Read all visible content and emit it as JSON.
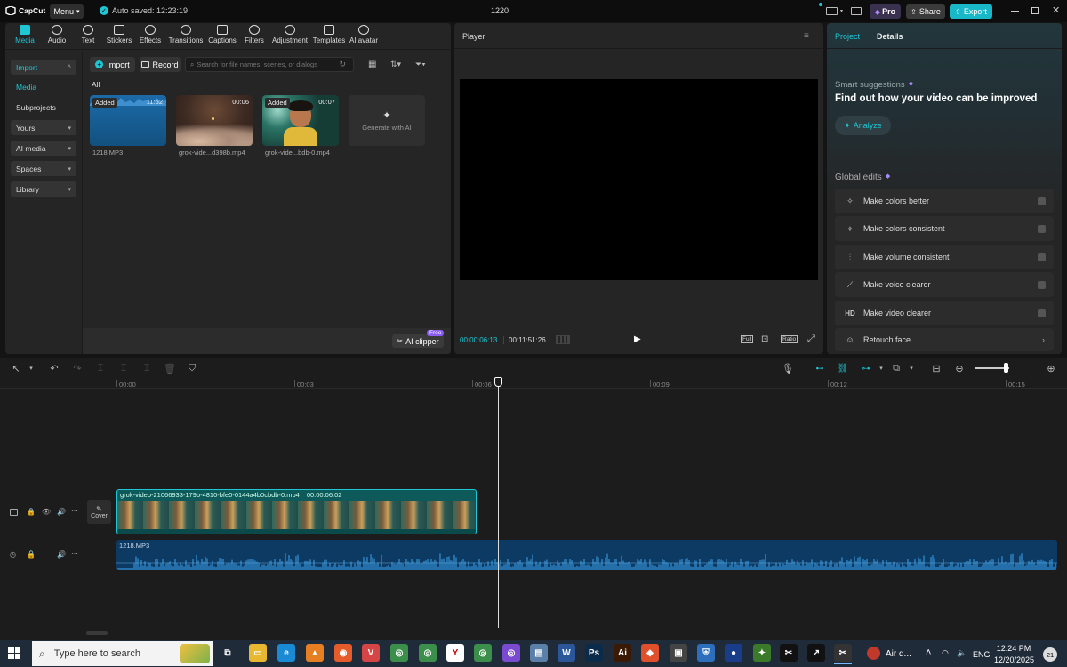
{
  "app": {
    "logo": "CapCut",
    "menu_label": "Menu",
    "autosave": "Auto saved: 12:23:19",
    "project_title": "1220",
    "pro_label": "Pro",
    "share_label": "Share",
    "export_label": "Export"
  },
  "toolbar": [
    {
      "label": "Media",
      "icon": "media-icon"
    },
    {
      "label": "Audio",
      "icon": "audio-icon"
    },
    {
      "label": "Text",
      "icon": "text-icon"
    },
    {
      "label": "Stickers",
      "icon": "stickers-icon"
    },
    {
      "label": "Effects",
      "icon": "effects-icon"
    },
    {
      "label": "Transitions",
      "icon": "transitions-icon"
    },
    {
      "label": "Captions",
      "icon": "captions-icon"
    },
    {
      "label": "Filters",
      "icon": "filters-icon"
    },
    {
      "label": "Adjustment",
      "icon": "adjustment-icon"
    },
    {
      "label": "Templates",
      "icon": "templates-icon"
    },
    {
      "label": "AI avatar",
      "icon": "ai-avatar-icon"
    }
  ],
  "sidebar": {
    "import": "Import",
    "media": "Media",
    "subprojects": "Subprojects",
    "yours": "Yours",
    "ai_media": "AI media",
    "spaces": "Spaces",
    "library": "Library"
  },
  "media": {
    "import_btn": "Import",
    "record_btn": "Record",
    "search_placeholder": "Search for file names, scenes, or dialogs",
    "filter_all": "All",
    "items": [
      {
        "name": "1218.MP3",
        "tag": "Added",
        "duration": "11:52"
      },
      {
        "name": "grok-vide...d398b.mp4",
        "tag": "",
        "duration": "00:06"
      },
      {
        "name": "grok-vide...bdb-0.mp4",
        "tag": "Added",
        "duration": "00:07"
      }
    ],
    "generate_label": "Generate with AI",
    "ai_clipper": "AI clipper",
    "free_badge": "Free"
  },
  "player": {
    "title": "Player",
    "current_time": "00:00:06:13",
    "total_time": "00:11:51:26",
    "full_label": "Full",
    "ratio_label": "Ratio"
  },
  "right": {
    "tab_project": "Project",
    "tab_details": "Details",
    "smart_title": "Smart suggestions",
    "smart_heading": "Find out how your video can be improved",
    "analyze": "Analyze",
    "global_title": "Global edits",
    "edits": [
      {
        "label": "Make colors better",
        "icon": "colors-better-icon"
      },
      {
        "label": "Make colors consistent",
        "icon": "colors-consistent-icon"
      },
      {
        "label": "Make volume consistent",
        "icon": "volume-consistent-icon"
      },
      {
        "label": "Make voice clearer",
        "icon": "voice-clearer-icon"
      },
      {
        "label": "Make video clearer",
        "icon": "hd-icon"
      },
      {
        "label": "Retouch face",
        "icon": "retouch-face-icon"
      }
    ]
  },
  "timeline": {
    "ruler": [
      "00:00",
      "00:03",
      "00:06",
      "00:09",
      "00:12",
      "00:15"
    ],
    "video_clip_label": "grok-video-21066933-179b-4810-bfe0-0144a4b0cbdb-0.mp4",
    "video_clip_duration": "00:00:06:02",
    "cover_label": "Cover",
    "audio_clip_label": "1218.MP3"
  },
  "taskbar": {
    "search_placeholder": "Type here to search",
    "weather": "Air q...",
    "lang": "ENG",
    "time": "12:24 PM",
    "date": "12/20/2025",
    "notif_count": "21"
  },
  "colors": {
    "accent": "#1fc6d4",
    "export_bg": "#19b8c8",
    "video_track": "#0e5a5a",
    "audio_track": "#0c3a63",
    "waveform": "#2f86c7"
  }
}
